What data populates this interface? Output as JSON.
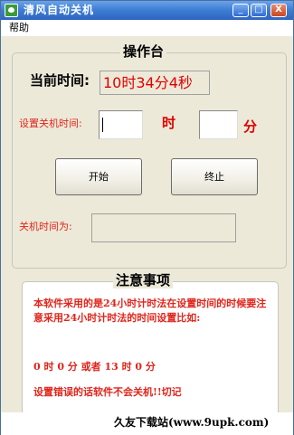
{
  "window": {
    "title": "清风自动关机",
    "minimize": "_",
    "maximize": "□",
    "close": "X"
  },
  "menu": {
    "help": "帮助"
  },
  "console": {
    "title": "操作台",
    "current_time_label": "当前时间:",
    "current_time_value": "10时34分4秒",
    "set_shutdown_label": "设置关机时间:",
    "hour_value": "",
    "minute_value": "",
    "hour_unit": "时",
    "minute_unit": "分",
    "start_button": "开始",
    "stop_button": "终止",
    "shutdown_time_label": "关机时间为:",
    "shutdown_time_value": ""
  },
  "notes": {
    "title": "注意事项",
    "line1": "本软件采用的是24小时计时法在设置时间的时候要注意采用24小时计时法的时间设置比如:",
    "line2": "0 时 0 分 或者 13 时 0 分",
    "line3": "设置错误的话软件不会关机!!切记"
  },
  "footer": {
    "text": "久友下载站(www.9upk.com)"
  }
}
